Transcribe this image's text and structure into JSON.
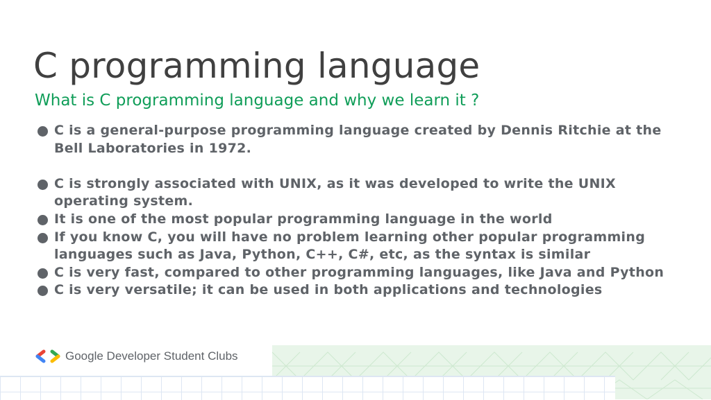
{
  "slide": {
    "title": "C programming language",
    "subtitle": "What is C programming language and why we learn it ?",
    "bullets": [
      "C is a general-purpose programming language created by Dennis Ritchie at the Bell Laboratories in 1972.",
      "C is strongly associated with UNIX, as it was developed to write the UNIX operating system.",
      "It is one of the most popular programming language in the world",
      "If you know C, you will have no problem learning other popular programming languages such as Java, Python, C++, C#, etc, as the syntax is similar",
      "C is very fast, compared to other programming languages, like Java and Python",
      "C is very versatile; it can be used in both applications and technologies"
    ],
    "footer": {
      "brand_text": "Google Developer Student Clubs",
      "logo_icon": "gdsc-logo-icon"
    }
  },
  "colors": {
    "title": "#404040",
    "subtitle": "#0f9d58",
    "body_text": "#5f6368",
    "accent_blue": "#4285f4",
    "accent_red": "#ea4335",
    "accent_green": "#34a853",
    "accent_yellow": "#fbbc04"
  }
}
